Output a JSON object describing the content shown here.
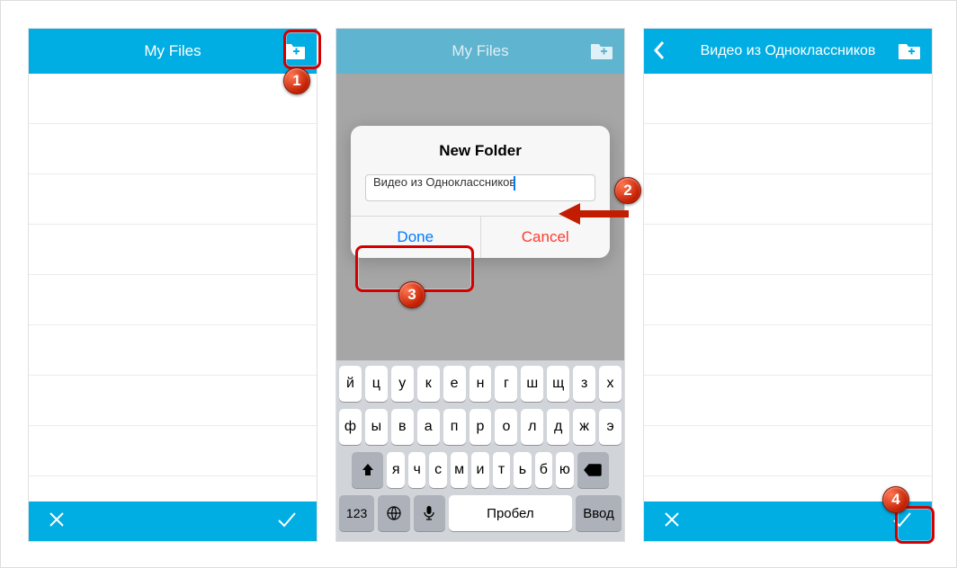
{
  "panel1": {
    "title": "My Files"
  },
  "panel2": {
    "title": "My Files",
    "dialog": {
      "title": "New Folder",
      "input_value": "Видео из Одноклассников",
      "done": "Done",
      "cancel": "Cancel"
    },
    "keyboard": {
      "row1": [
        "й",
        "ц",
        "у",
        "к",
        "е",
        "н",
        "г",
        "ш",
        "щ",
        "з",
        "х"
      ],
      "row2": [
        "ф",
        "ы",
        "в",
        "а",
        "п",
        "р",
        "о",
        "л",
        "д",
        "ж",
        "э"
      ],
      "row3": [
        "я",
        "ч",
        "с",
        "м",
        "и",
        "т",
        "ь",
        "б",
        "ю"
      ],
      "num": "123",
      "space": "Пробел",
      "enter": "Ввод"
    }
  },
  "panel3": {
    "title": "Видео из Одноклассников"
  },
  "badges": {
    "b1": "1",
    "b2": "2",
    "b3": "3",
    "b4": "4"
  }
}
